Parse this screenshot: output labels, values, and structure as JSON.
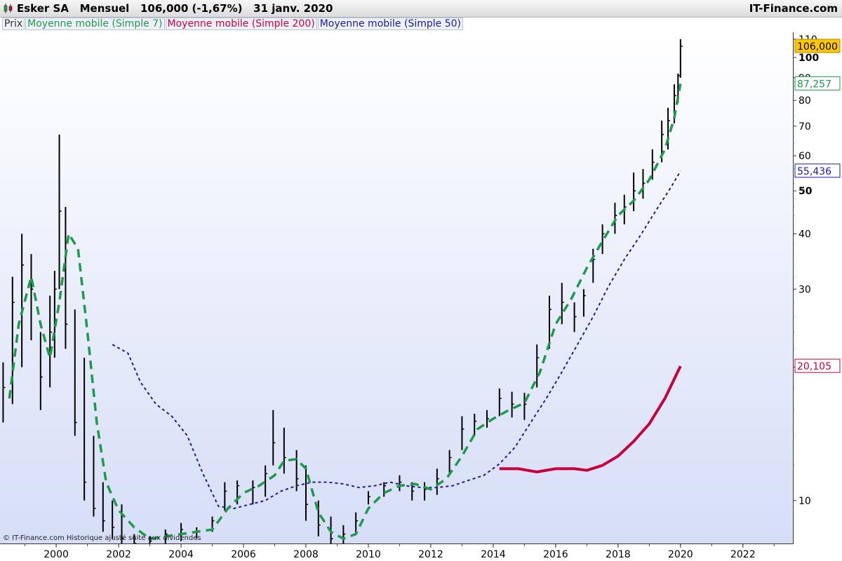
{
  "header": {
    "title": "Esker SA   Mensuel   106,000 (-1,67%)   31 janv. 2020",
    "brand": "IT-Finance.com"
  },
  "legend": {
    "prix": "Prix",
    "sma7": "Moyenne mobile (Simple 7)",
    "sma200": "Moyenne mobile (Simple 200)",
    "sma50": "Moyenne mobile (Simple 50)"
  },
  "footer": "© IT-Finance.com  Historique ajusté suite aux dividendes",
  "colors": {
    "price": "#000000",
    "sma7": "#1d9a4a",
    "sma200": "#c8003c",
    "sma50": "#1a1aa5",
    "last_price_bg": "#ffc800",
    "background_top": "#ffffff",
    "background_bottom": "#d6def7"
  },
  "chart_data": {
    "type": "line",
    "scale": "log",
    "ylim": [
      8,
      114
    ],
    "xlim": [
      1998.2,
      2023.6
    ],
    "x_ticks": [
      "2000",
      "2002",
      "2004",
      "2006",
      "2008",
      "2010",
      "2012",
      "2014",
      "2016",
      "2018",
      "2020",
      "2022"
    ],
    "y_ticks": [
      {
        "value": 10,
        "label": "10",
        "bold": false
      },
      {
        "value": 20,
        "label": "20",
        "bold": false,
        "hidden": true
      },
      {
        "value": 30,
        "label": "30",
        "bold": false
      },
      {
        "value": 40,
        "label": "40",
        "bold": false
      },
      {
        "value": 50,
        "label": "50",
        "bold": true
      },
      {
        "value": 60,
        "label": "60",
        "bold": false
      },
      {
        "value": 70,
        "label": "70",
        "bold": false
      },
      {
        "value": 80,
        "label": "80",
        "bold": false
      },
      {
        "value": 90,
        "label": "90",
        "bold": false
      },
      {
        "value": 100,
        "label": "100",
        "bold": true
      },
      {
        "value": 110,
        "label": "110",
        "bold": false
      }
    ],
    "last_values": [
      {
        "series": "Prix",
        "value": 106,
        "label": "106,000",
        "color": "#ffc800",
        "filled": true
      },
      {
        "series": "Moyenne mobile (Simple 7)",
        "value": 87.257,
        "label": "87,257",
        "color": "#1d9a4a",
        "filled": false
      },
      {
        "series": "Moyenne mobile (Simple 50)",
        "value": 55.436,
        "label": "55,436",
        "color": "#1a1aa5",
        "filled": false
      },
      {
        "series": "Moyenne mobile (Simple 200)",
        "value": 20.105,
        "label": "20,105",
        "color": "#c8003c",
        "filled": false
      }
    ],
    "price": {
      "name": "Prix",
      "x": [
        1998.3,
        1998.6,
        1998.9,
        1999.2,
        1999.5,
        1999.8,
        1999.95,
        2000.1,
        2000.3,
        2000.6,
        2000.9,
        2001.2,
        2001.5,
        2001.8,
        2002.1,
        2002.5,
        2003.0,
        2003.5,
        2004.0,
        2004.5,
        2005.0,
        2005.4,
        2005.8,
        2006.3,
        2006.7,
        2006.95,
        2007.3,
        2007.7,
        2008.0,
        2008.4,
        2008.8,
        2009.2,
        2009.6,
        2010.0,
        2010.5,
        2011.0,
        2011.4,
        2011.8,
        2012.2,
        2012.6,
        2013.0,
        2013.4,
        2013.8,
        2014.2,
        2014.6,
        2015.0,
        2015.4,
        2015.8,
        2016.2,
        2016.6,
        2016.9,
        2017.2,
        2017.5,
        2017.9,
        2018.2,
        2018.5,
        2018.8,
        2019.1,
        2019.4,
        2019.6,
        2019.8,
        2019.92,
        2020.0
      ],
      "high": [
        20.5,
        32,
        40,
        36,
        24,
        29,
        33,
        67,
        46,
        27,
        21,
        14,
        11,
        10,
        9.8,
        8.4,
        8.3,
        8.6,
        8.9,
        8.7,
        9.2,
        11,
        11.1,
        11.1,
        12,
        16,
        14.6,
        13,
        12,
        10,
        9.2,
        8.8,
        9.4,
        10.5,
        11,
        11.4,
        11,
        11,
        11.8,
        13,
        15.5,
        15.7,
        16,
        17.9,
        17.6,
        17.5,
        22.5,
        29,
        31,
        28,
        30,
        37,
        42,
        47,
        49,
        55,
        56,
        62,
        72,
        77,
        87,
        92,
        110
      ],
      "low": [
        15,
        16.5,
        20,
        23,
        16,
        18,
        21,
        30,
        22,
        14,
        10,
        9.2,
        8.5,
        8.2,
        7.8,
        7.6,
        7.8,
        8,
        8.1,
        8.2,
        8.5,
        9.5,
        9.8,
        9.8,
        10.2,
        12,
        11.5,
        10.5,
        9,
        8.3,
        7.8,
        7.8,
        8.4,
        9.8,
        10.2,
        10.5,
        10,
        10,
        10.3,
        11.5,
        13,
        14,
        14.6,
        15.5,
        15.4,
        15.2,
        18,
        22,
        25,
        24,
        26,
        31,
        36,
        40,
        42,
        45,
        48,
        53,
        58,
        62,
        71,
        79,
        90
      ],
      "close": [
        18,
        28,
        34,
        30,
        19,
        24,
        30,
        45,
        25,
        15,
        11,
        9.6,
        9,
        8.7,
        8.2,
        8,
        8.1,
        8.4,
        8.6,
        8.5,
        9,
        10.5,
        10.8,
        10.7,
        11.5,
        13.5,
        12.5,
        11.2,
        9.8,
        8.8,
        8.2,
        8.4,
        9,
        10.2,
        10.8,
        11,
        10.5,
        10.6,
        11.2,
        12.5,
        14.5,
        15.1,
        15.3,
        17,
        16.5,
        16.5,
        21,
        27,
        28,
        26,
        29,
        35,
        40,
        44,
        46,
        50,
        52,
        58,
        67,
        72,
        82,
        91,
        106
      ]
    },
    "sma7": {
      "name": "Moyenne mobile (Simple 7)",
      "x": [
        1998.5,
        1998.8,
        1999.2,
        1999.5,
        1999.8,
        2000.1,
        2000.4,
        2000.7,
        2001.0,
        2001.3,
        2001.6,
        2002.0,
        2002.5,
        2003.0,
        2003.5,
        2004.0,
        2004.5,
        2005.0,
        2005.5,
        2006.0,
        2006.5,
        2007.0,
        2007.3,
        2007.7,
        2008.0,
        2008.4,
        2008.8,
        2009.2,
        2009.6,
        2010.0,
        2010.5,
        2011.0,
        2011.5,
        2012.0,
        2012.5,
        2013.0,
        2013.5,
        2014.0,
        2014.5,
        2015.0,
        2015.5,
        2016.0,
        2016.5,
        2017.0,
        2017.5,
        2018.0,
        2018.5,
        2019.0,
        2019.5,
        2019.8,
        2020.0
      ],
      "y": [
        17,
        25,
        32,
        25,
        21,
        28,
        40,
        37,
        24,
        15,
        11,
        9.5,
        8.7,
        8.2,
        8.3,
        8.4,
        8.5,
        8.6,
        9.6,
        10.4,
        10.8,
        11.4,
        12.3,
        12.4,
        11.8,
        9.4,
        8.5,
        8.2,
        8.4,
        9.6,
        10.4,
        10.8,
        10.9,
        10.6,
        11.2,
        12.6,
        14.5,
        15.3,
        16,
        16.6,
        19.5,
        25,
        28.5,
        33.5,
        38.5,
        44,
        47.5,
        53,
        62,
        73,
        87.257
      ]
    },
    "sma200": {
      "name": "Moyenne mobile (Simple 200)",
      "x": [
        2014.2,
        2014.8,
        2015.4,
        2016.0,
        2016.6,
        2017.0,
        2017.5,
        2018.0,
        2018.5,
        2019.0,
        2019.5,
        2020.0
      ],
      "y": [
        11.8,
        11.8,
        11.6,
        11.8,
        11.8,
        11.7,
        12,
        12.6,
        13.6,
        14.9,
        17,
        20.105
      ]
    },
    "sma50": {
      "name": "Moyenne mobile (Simple 50)",
      "x": [
        2001.8,
        2002.3,
        2002.7,
        2003.2,
        2003.7,
        2004.2,
        2004.7,
        2005.2,
        2005.7,
        2006.2,
        2006.7,
        2007.2,
        2007.7,
        2008.2,
        2008.7,
        2009.2,
        2009.7,
        2010.2,
        2010.7,
        2011.2,
        2011.7,
        2012.2,
        2012.7,
        2013.2,
        2013.7,
        2014.2,
        2014.7,
        2015.2,
        2015.7,
        2016.2,
        2016.7,
        2017.2,
        2017.7,
        2018.2,
        2018.7,
        2019.2,
        2019.7,
        2020.0
      ],
      "y": [
        22.5,
        21.5,
        18.5,
        16.5,
        15.5,
        14,
        11.5,
        9.7,
        9.6,
        9.8,
        10,
        10.5,
        10.8,
        11,
        11,
        10.9,
        10.7,
        10.8,
        11,
        10.8,
        10.7,
        10.7,
        10.8,
        11.1,
        11.4,
        12.1,
        13.2,
        15,
        17,
        19.5,
        22.5,
        26,
        30.5,
        35,
        39.5,
        45,
        51,
        55.436
      ]
    }
  }
}
